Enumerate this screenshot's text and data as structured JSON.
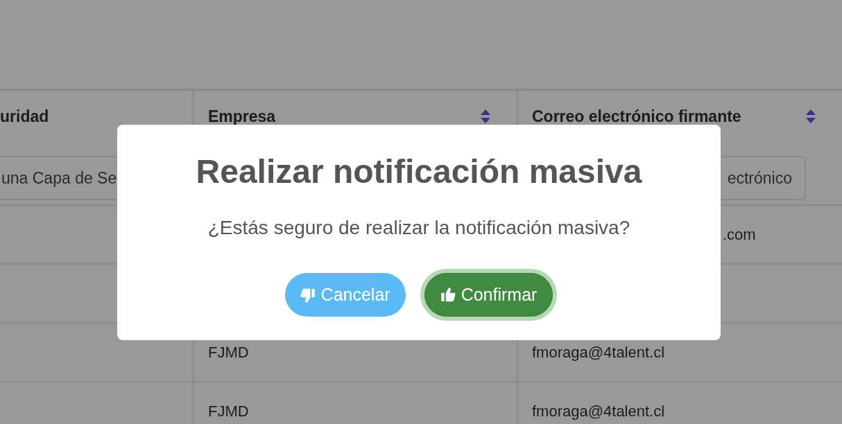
{
  "table": {
    "columns": [
      {
        "label": "uridad",
        "sortable": false,
        "filter": "una Capa de Se"
      },
      {
        "label": "Empresa",
        "sortable": true
      },
      {
        "label": "Correo electrónico firmante",
        "sortable": true,
        "filter": "ectrónico"
      }
    ],
    "rows": [
      {
        "covered": true,
        "column_3": ".com"
      },
      {},
      {
        "covered": false,
        "column_2": "FJMD",
        "column_3": "fmoraga@4talent.cl"
      },
      {
        "covered": false,
        "column_2": "FJMD",
        "column_3": "fmoraga@4talent.cl"
      }
    ]
  },
  "dialog": {
    "title": "Realizar notificación masiva",
    "message": "¿Estás seguro de realizar la notificación masiva?",
    "buttons": [
      {
        "kind": "cancel",
        "label": "Cancelar",
        "focused": false
      },
      {
        "kind": "confirm",
        "label": "Confirmar",
        "focused": true
      }
    ]
  }
}
